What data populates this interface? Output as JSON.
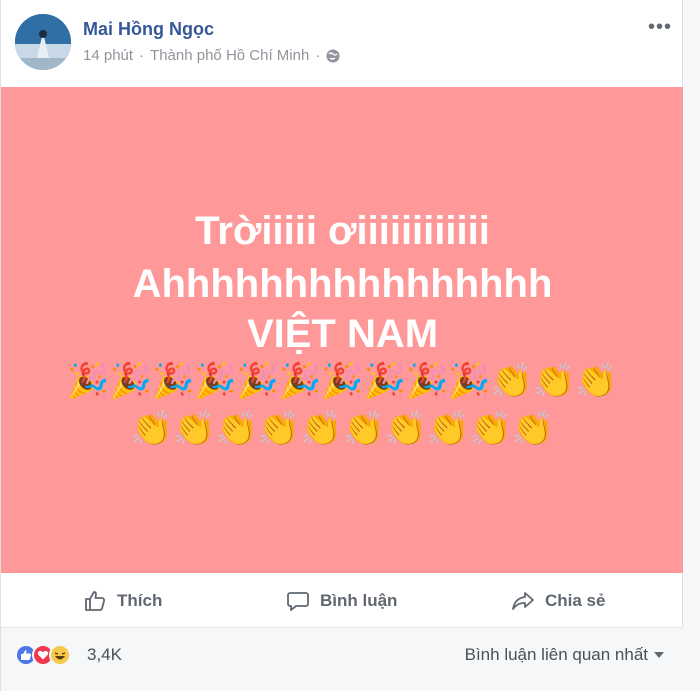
{
  "post": {
    "author": "Mai Hồng Ngọc",
    "time": "14 phút",
    "separator": "·",
    "location": "Thành phố Hồ Chí Minh",
    "separator2": "·",
    "lines": [
      "Trờiiiii ơiiiiiiiiiiii",
      "Ahhhhhhhhhhhhhhhh",
      "VIỆT NAM"
    ],
    "emoji_row_1": "🎉🎉🎉🎉🎉🎉🎉🎉🎉🎉👏👏👏",
    "emoji_row_2": "👏👏👏👏👏👏👏👏👏👏",
    "background_color": "#fe9899"
  },
  "actions": {
    "like_label": "Thích",
    "comment_label": "Bình luận",
    "share_label": "Chia sẻ"
  },
  "reactions": {
    "count": "3,4K",
    "icons": [
      "like-icon",
      "love-icon",
      "haha-icon"
    ],
    "sort_label": "Bình luận liên quan nhất"
  }
}
